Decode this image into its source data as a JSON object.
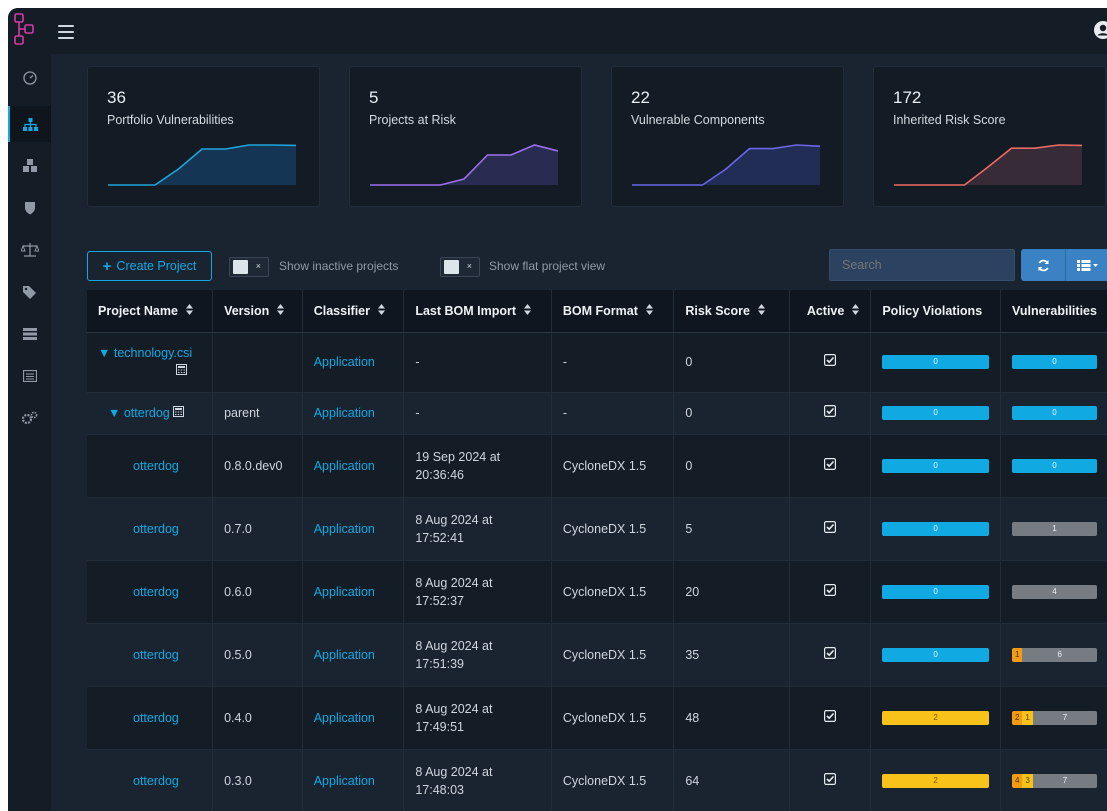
{
  "colors": {
    "accent": "#11a9e1",
    "background": "#1a2330",
    "violations_yellow": "#f7c21a",
    "vuln_orange": "#f39c12",
    "unassigned_grey": "#777c82"
  },
  "topbar": {
    "logo_icon": "dependency-track-logo",
    "menu_icon": "hamburger-icon",
    "user_icon": "user-avatar-icon"
  },
  "sidebar": {
    "items": [
      {
        "icon": "dashboard-gauge-icon",
        "active": false
      },
      {
        "icon": "projects-sitemap-icon",
        "active": true
      },
      {
        "icon": "components-cubes-icon",
        "active": false
      },
      {
        "icon": "vulnerabilities-shield-icon",
        "active": false
      },
      {
        "icon": "licenses-balance-icon",
        "active": false
      },
      {
        "icon": "tags-icon",
        "active": false
      },
      {
        "icon": "policy-server-icon",
        "active": false
      },
      {
        "icon": "audit-list-icon",
        "active": false
      },
      {
        "icon": "administration-cogs-icon",
        "active": false
      }
    ]
  },
  "metrics": [
    {
      "value": "36",
      "label": "Portfolio Vulnerabilities",
      "color": "#1ea5db",
      "fill": "#15385a",
      "trend": [
        0,
        0,
        0,
        0.4,
        0.9,
        0.9,
        1,
        1,
        0.99
      ]
    },
    {
      "value": "5",
      "label": "Projects at Risk",
      "color": "#a06ef0",
      "fill": "#2b2f55",
      "trend": [
        0,
        0,
        0,
        0,
        0.15,
        0.75,
        0.75,
        1,
        0.85
      ]
    },
    {
      "value": "22",
      "label": "Vulnerable Components",
      "color": "#6a66e6",
      "fill": "#23305a",
      "trend": [
        0,
        0,
        0,
        0,
        0.4,
        0.91,
        0.91,
        1,
        0.97
      ]
    },
    {
      "value": "172",
      "label": "Inherited Risk Score",
      "color": "#ef6a63",
      "fill": "#3b2d3a",
      "trend": [
        0,
        0,
        0,
        0,
        0.45,
        0.92,
        0.92,
        1,
        0.99
      ]
    }
  ],
  "toolbar": {
    "create_project": "Create Project",
    "show_inactive": "Show inactive projects",
    "show_flat": "Show flat project view",
    "toggle_x": "×",
    "search_placeholder": "Search",
    "refresh_icon": "refresh-icon",
    "columns_icon": "column-list-icon"
  },
  "table": {
    "headers": [
      "Project Name",
      "Version",
      "Classifier",
      "Last BOM Import",
      "BOM Format",
      "Risk Score",
      "Active",
      "Policy Violations",
      "Vulnerabilities"
    ],
    "rows": [
      {
        "name": "technology.csi",
        "level": 0,
        "expander": "▼",
        "version": "",
        "classifier": "Application",
        "last_import_1": "-",
        "last_import_2": "",
        "bom_format": "-",
        "risk": "0",
        "violations": {
          "type": "blue",
          "total": "0"
        },
        "vulns": {
          "type": "blue",
          "total": "0"
        }
      },
      {
        "name": "otterdog",
        "level": 1,
        "expander": "▼",
        "version": "parent",
        "classifier": "Application",
        "last_import_1": "-",
        "last_import_2": "",
        "bom_format": "-",
        "risk": "0",
        "violations": {
          "type": "blue",
          "total": "0"
        },
        "vulns": {
          "type": "blue",
          "total": "0"
        }
      },
      {
        "name": "otterdog",
        "level": 2,
        "expander": "",
        "version": "0.8.0.dev0",
        "classifier": "Application",
        "last_import_1": "19 Sep 2024 at",
        "last_import_2": "20:36:46",
        "bom_format": "CycloneDX 1.5",
        "risk": "0",
        "violations": {
          "type": "blue",
          "total": "0"
        },
        "vulns": {
          "type": "blue",
          "total": "0"
        }
      },
      {
        "name": "otterdog",
        "level": 2,
        "expander": "",
        "version": "0.7.0",
        "classifier": "Application",
        "last_import_1": "8 Aug 2024 at",
        "last_import_2": "17:52:41",
        "bom_format": "CycloneDX 1.5",
        "risk": "5",
        "violations": {
          "type": "blue",
          "total": "0"
        },
        "vulns": {
          "type": "grey",
          "total": "1"
        }
      },
      {
        "name": "otterdog",
        "level": 2,
        "expander": "",
        "version": "0.6.0",
        "classifier": "Application",
        "last_import_1": "8 Aug 2024 at",
        "last_import_2": "17:52:37",
        "bom_format": "CycloneDX 1.5",
        "risk": "20",
        "violations": {
          "type": "blue",
          "total": "0"
        },
        "vulns": {
          "type": "grey",
          "total": "4"
        }
      },
      {
        "name": "otterdog",
        "level": 2,
        "expander": "",
        "version": "0.5.0",
        "classifier": "Application",
        "last_import_1": "8 Aug 2024 at",
        "last_import_2": "17:51:39",
        "bom_format": "CycloneDX 1.5",
        "risk": "35",
        "violations": {
          "type": "blue",
          "total": "0"
        },
        "vulns": {
          "type": "mixed",
          "high": "1",
          "medium": "",
          "rest": "6"
        }
      },
      {
        "name": "otterdog",
        "level": 2,
        "expander": "",
        "version": "0.4.0",
        "classifier": "Application",
        "last_import_1": "8 Aug 2024 at",
        "last_import_2": "17:49:51",
        "bom_format": "CycloneDX 1.5",
        "risk": "48",
        "violations": {
          "type": "yellow",
          "total": "2"
        },
        "vulns": {
          "type": "mixed",
          "high": "2",
          "medium": "1",
          "rest": "7"
        }
      },
      {
        "name": "otterdog",
        "level": 2,
        "expander": "",
        "version": "0.3.0",
        "classifier": "Application",
        "last_import_1": "8 Aug 2024 at",
        "last_import_2": "17:48:03",
        "bom_format": "CycloneDX 1.5",
        "risk": "64",
        "violations": {
          "type": "yellow",
          "total": "2"
        },
        "vulns": {
          "type": "mixed",
          "high": "4",
          "medium": "3",
          "rest": "7"
        }
      }
    ]
  }
}
